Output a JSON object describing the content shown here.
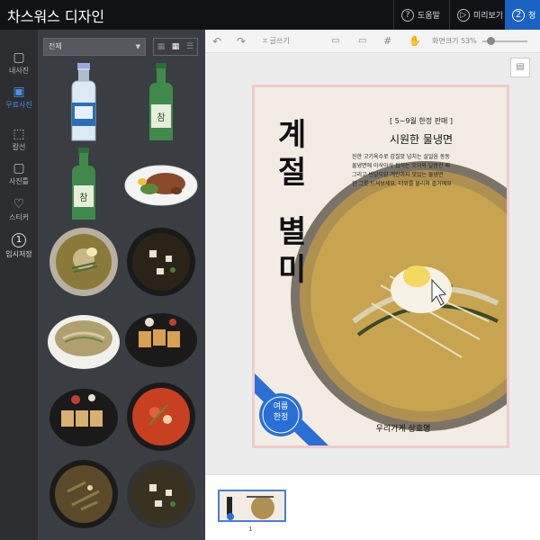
{
  "app": {
    "title": "차스워스 디자인"
  },
  "topbar": {
    "help": "도움말",
    "preview": "미리보기",
    "step": "2",
    "step_label": "청"
  },
  "leftnav": [
    {
      "label": "내사진",
      "icon": "camera-icon"
    },
    {
      "label": "무료사진",
      "icon": "free-photo-icon"
    },
    {
      "label": "칼선",
      "icon": "cut-line-icon"
    },
    {
      "label": "사진틀",
      "icon": "frame-icon"
    },
    {
      "label": "스티커",
      "icon": "heart-icon"
    },
    {
      "label": "임시저장",
      "icon": "save-circle-icon",
      "badge": "1"
    }
  ],
  "panel": {
    "category": "전체"
  },
  "toolbar": {
    "text_tool": "글쓰기",
    "zoom_label": "화면크기 53%"
  },
  "poster": {
    "vertical_title_1": "계절",
    "vertical_title_2": "별미",
    "tagline": "[ 5~9월 한정 판매 ]",
    "headline": "시원한 물냉면",
    "desc_1": "진한 고기육수로 감칠맛 넘치는 살얼음 동동",
    "desc_2": "물냉면에 아삭아삭 씹히는 오이와 달콤한 배",
    "desc_3": "그리고 반달모양 계란까지 맛있는 물냉면",
    "desc_4": "한 그릇 드셔보세요. 더위를 물리쳐 줍거예요",
    "badge_1": "여름",
    "badge_2": "한정",
    "shop": "우리가게 상호명"
  },
  "pages": {
    "number": "1"
  },
  "colors": {
    "accent": "#1a63c4",
    "badge": "#2a6fd6"
  }
}
